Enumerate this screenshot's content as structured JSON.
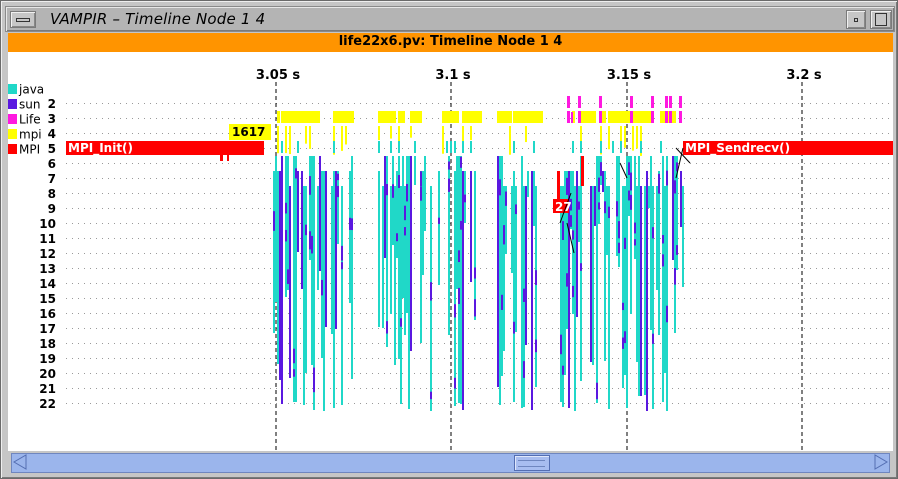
{
  "window": {
    "title": "VAMPIR – Timeline Node 1 4",
    "subtitle": "life22x6.pv: Timeline Node 1 4"
  },
  "icons": {
    "menu": "window-menu-icon",
    "minimize": "minimize-icon",
    "maximize": "maximize-icon",
    "scroll_left": "scroll-left-arrow-icon",
    "scroll_right": "scroll-right-arrow-icon"
  },
  "legend": [
    {
      "name": "java",
      "color": "#20d8c8"
    },
    {
      "name": "sun",
      "color": "#5a18e0"
    },
    {
      "name": "Life",
      "color": "#ff18e0"
    },
    {
      "name": "mpi",
      "color": "#ffff00"
    },
    {
      "name": "MPI",
      "color": "#ff0000"
    }
  ],
  "time_axis": {
    "ticks": [
      "3.05 s",
      "3.1 s",
      "3.15 s",
      "3.2 s"
    ],
    "tick_times": [
      3.05,
      3.1,
      3.15,
      3.2
    ],
    "range": [
      2.99,
      3.226
    ]
  },
  "threads": [
    "2",
    "3",
    "4",
    "5",
    "6",
    "7",
    "8",
    "9",
    "10",
    "11",
    "12",
    "13",
    "14",
    "15",
    "16",
    "17",
    "18",
    "19",
    "20",
    "21",
    "22"
  ],
  "state_labels": [
    {
      "text": "MPI_Init()",
      "thread": "5"
    },
    {
      "text": "1617",
      "thread": "4"
    },
    {
      "text": "MPI_Sendrecv()",
      "thread": "5"
    },
    {
      "text": "27",
      "thread": "9"
    }
  ],
  "scrollbar": {
    "position": 0.6
  }
}
